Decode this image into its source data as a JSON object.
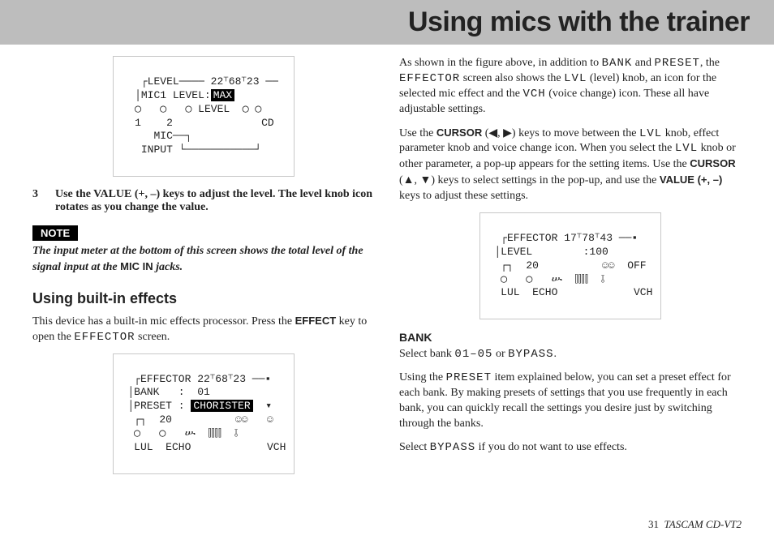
{
  "title": "Using mics with the trainer",
  "fig1": {
    "l1": "   ┌LEVEL──── 22⸆68⸆23 ──",
    "l2a": "  │MIC1 LEVEL:",
    "l2b": "MAX",
    "l2c": "        ",
    "l3": "  ◯   ◯   ◯ LEVEL  ◯ ◯",
    "l4": "  1    2              CD",
    "l5": "     MIC──┐            ",
    "l6": "   INPUT └───────────┘"
  },
  "step3": {
    "num": "3",
    "text": "Use the VALUE (+, –) keys to adjust the level. The level knob icon rotates as you change the value."
  },
  "note": {
    "label": "NOTE",
    "body_a": "The input meter at the bottom of this screen shows the total level of the signal input at the ",
    "body_mic": "MIC IN",
    "body_b": " jacks."
  },
  "effects_head": "Using built-in effects",
  "effects_p1_a": "This device has a built-in mic effects processor. Press the ",
  "effects_p1_key": "EFFECT",
  "effects_p1_b": " key to open the ",
  "effects_p1_term": "EFFECTOR",
  "effects_p1_c": " screen.",
  "fig2": {
    "l1": "  ┌EFFECTOR 22⸆68⸆23 ──▪",
    "l2": " │BANK   :  01",
    "l3a": " │PRESET : ",
    "l3b": "CHORISTER",
    "l3c": "  ▾",
    "l4": "  ┌┐  20          ☺☺   ☺",
    "l5": "  ◯   ◯   ሡ  ⫿⫿⫿⫿  ⫱",
    "l6": "  LUL  ECHO            VCH"
  },
  "right_p1": {
    "a": "As shown in the figure above, in addition to ",
    "t1": "BANK",
    "b": " and ",
    "t2": "PRESET",
    "c": ", the ",
    "t3": "EFFECTOR",
    "d": " screen also shows the ",
    "t4": "LVL",
    "e": " (level) knob, an icon for the selected mic effect and the ",
    "t5": "VCH",
    "f": " (voice change) icon. These all have adjustable settings."
  },
  "right_p2": {
    "a": "Use the ",
    "k1": "CURSOR",
    "b": " (◀, ▶) keys to move between the ",
    "t1": "LVL",
    "c": " knob, effect parameter knob and voice change icon. When you select the ",
    "t2": "LVL",
    "d": " knob or other parameter, a pop-up appears for the setting items. Use the ",
    "k2": "CURSOR",
    "e": " (▲, ▼) keys to select settings in the pop-up, and use the ",
    "k3": "VALUE (+, –)",
    "f": " keys to adjust these settings."
  },
  "fig3": {
    "l1": "  ┌EFFECTOR 17⸆78⸆43 ──▪",
    "l2": " │LEVEL        :100  ",
    "l3": "  ┌┐  20          ☺☺  OFF",
    "l4": "  ◯   ◯   ሡ  ⫿⫿⫿⫿  ⫱",
    "l5": "  LUL  ECHO            VCH"
  },
  "bank": {
    "head": "BANK",
    "p1a": "Select bank ",
    "p1t1": "01–05",
    "p1b": " or ",
    "p1t2": "BYPASS",
    "p1c": ".",
    "p2a": "Using the ",
    "p2t": "PRESET",
    "p2b": " item explained below, you can set a preset effect for each bank. By making presets of settings that you use frequently in each bank, you can quickly recall the settings you desire just by switching through the banks.",
    "p3a": "Select ",
    "p3t": "BYPASS",
    "p3b": " if you do not want to use effects."
  },
  "footer": {
    "page": "31",
    "product": "TASCAM  CD-VT2"
  }
}
